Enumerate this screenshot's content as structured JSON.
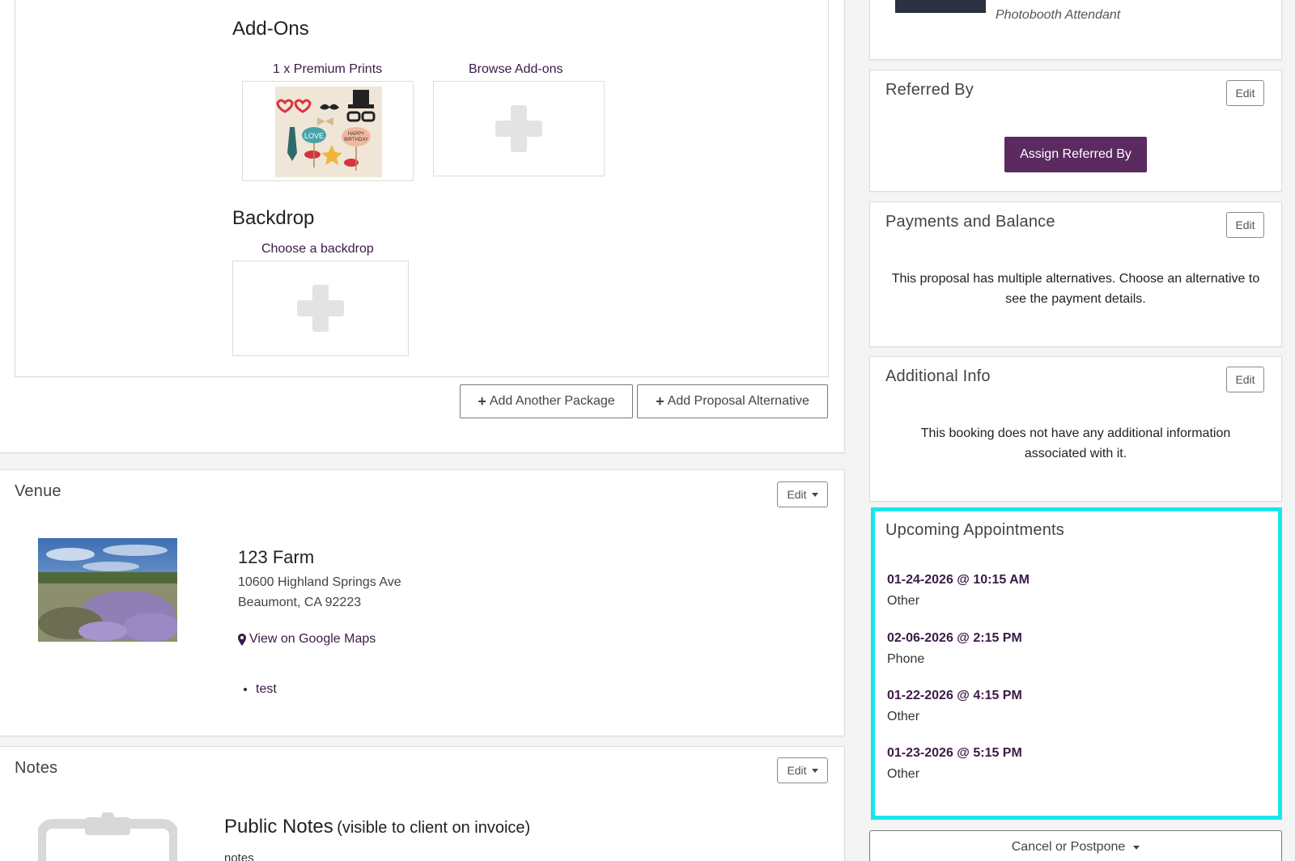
{
  "package": {
    "addons_heading": "Add-Ons",
    "addon_item_label": "1 x Premium Prints",
    "browse_addons_label": "Browse Add-ons",
    "backdrop_heading": "Backdrop",
    "choose_backdrop_label": "Choose a backdrop",
    "add_package_label": "Add Another Package",
    "add_alternative_label": "Add Proposal Alternative",
    "props": {
      "love": "LOVE",
      "happy": "HAPPY",
      "birthday": "BIRTHDAY"
    }
  },
  "venue": {
    "title": "Venue",
    "edit_label": "Edit",
    "name": "123 Farm",
    "address_line1": "10600 Highland Springs Ave",
    "address_line2": "Beaumont, CA 92223",
    "map_link": "View on Google Maps",
    "bullets": [
      "test"
    ]
  },
  "notes": {
    "title": "Notes",
    "edit_label": "Edit",
    "public_heading": "Public Notes",
    "public_subheading": "(visible to client on invoice)",
    "body": "notes"
  },
  "staff": {
    "role": "Photobooth Attendant"
  },
  "referred_by": {
    "title": "Referred By",
    "edit_label": "Edit",
    "assign_label": "Assign Referred By"
  },
  "payments": {
    "title": "Payments and Balance",
    "edit_label": "Edit",
    "message": "This proposal has multiple alternatives. Choose an alternative to see the payment details."
  },
  "additional_info": {
    "title": "Additional Info",
    "edit_label": "Edit",
    "message": "This booking does not have any additional information associated with it."
  },
  "appointments": {
    "title": "Upcoming Appointments",
    "highlight_color": "#19e6ec",
    "items": [
      {
        "datetime": "01-24-2026 @ 10:15 AM",
        "type": "Other"
      },
      {
        "datetime": "02-06-2026 @ 2:15 PM",
        "type": "Phone"
      },
      {
        "datetime": "01-22-2026 @ 4:15 PM",
        "type": "Other"
      },
      {
        "datetime": "01-23-2026 @ 5:15 PM",
        "type": "Other"
      }
    ]
  },
  "cancel_postpone_label": "Cancel or Postpone",
  "colors": {
    "brand_purple": "#5a2a60",
    "link_purple": "#3c1a48"
  }
}
